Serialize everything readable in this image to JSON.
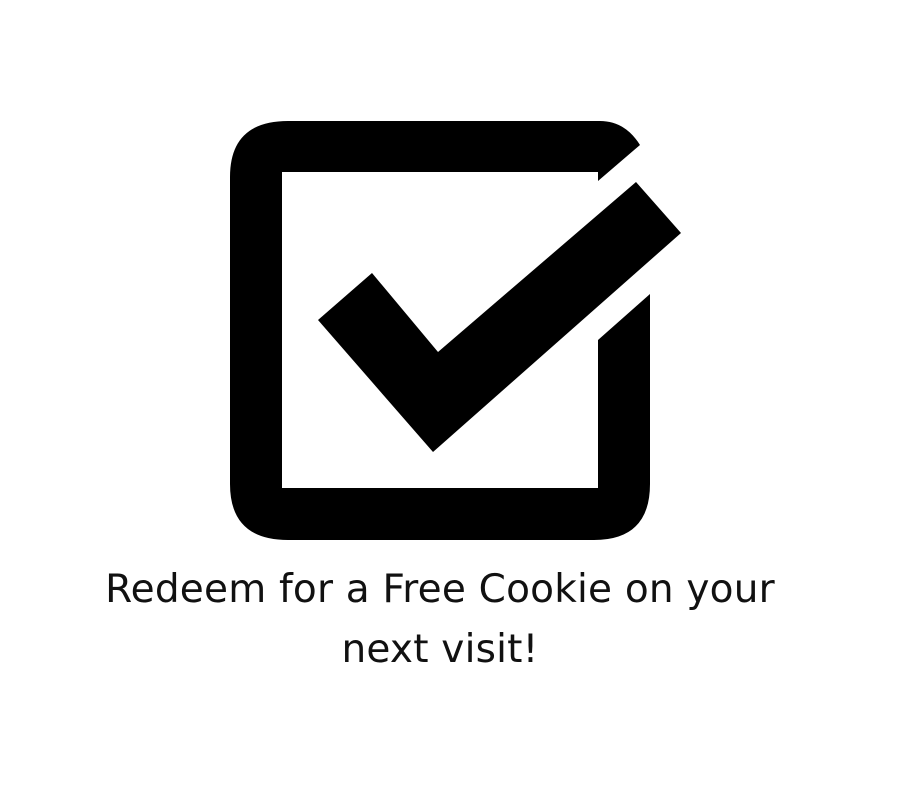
{
  "graphic": {
    "icon": "checked-checkbox-icon",
    "color": "#000000",
    "background": "#ffffff"
  },
  "message": {
    "text": "Redeem for a Free Cookie on your next visit!"
  }
}
